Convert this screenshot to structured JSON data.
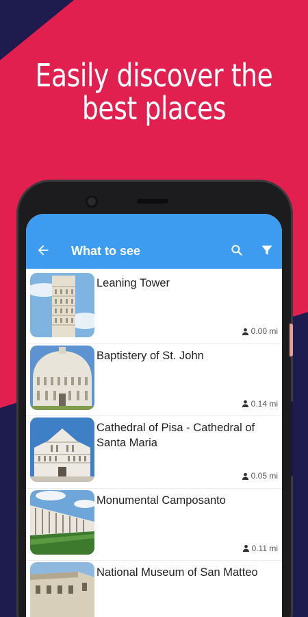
{
  "colors": {
    "background": "#E2204F",
    "navy": "#1E1B4E",
    "appbar": "#3D9BF0"
  },
  "headline": {
    "line1": "Easily discover the",
    "line2": "best places"
  },
  "appbar": {
    "title": "What to see",
    "back_icon": "arrow-left-icon",
    "search_icon": "search-icon",
    "filter_icon": "filter-icon"
  },
  "places": [
    {
      "name": "Leaning Tower",
      "distance": "0.00 mi"
    },
    {
      "name": "Baptistery of St. John",
      "distance": "0.14 mi"
    },
    {
      "name": "Cathedral of Pisa - Cathedral of Santa Maria",
      "distance": "0.05 mi"
    },
    {
      "name": "Monumental Camposanto",
      "distance": "0.11 mi"
    },
    {
      "name": "National Museum of San Matteo",
      "distance": ""
    }
  ]
}
